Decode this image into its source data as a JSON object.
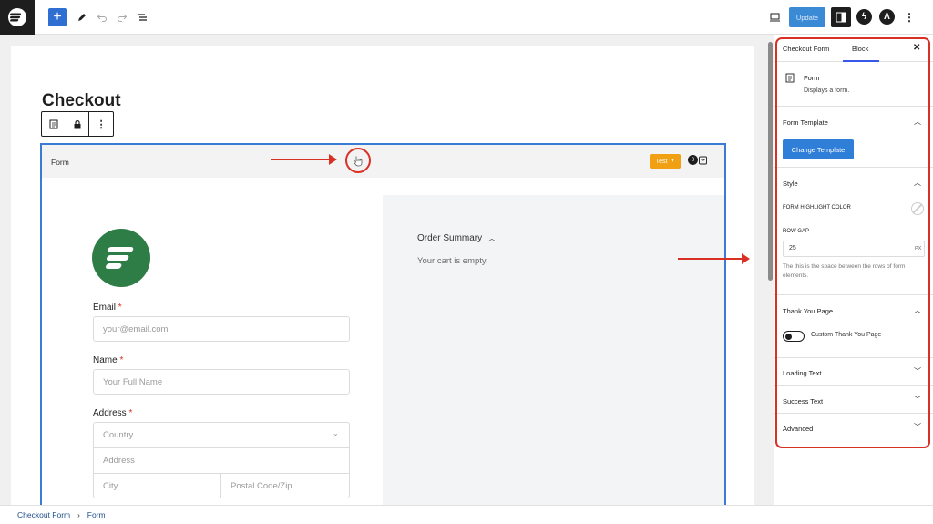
{
  "toolbar": {
    "update_label": "Update"
  },
  "page": {
    "title": "Checkout"
  },
  "form_block": {
    "label": "Form",
    "test_label": "Test",
    "cart_count": "0",
    "fields": {
      "email_label": "Email",
      "email_placeholder": "your@email.com",
      "name_label": "Name",
      "name_placeholder": "Your Full Name",
      "address_label": "Address",
      "country_placeholder": "Country",
      "address_placeholder": "Address",
      "city_placeholder": "City",
      "postal_placeholder": "Postal Code/Zip",
      "required_mark": "*"
    },
    "summary": {
      "title": "Order Summary",
      "empty_text": "Your cart is empty."
    }
  },
  "sidebar": {
    "tabs": [
      "Checkout Form",
      "Block"
    ],
    "block_name": "Form",
    "block_description": "Displays a form.",
    "sections": {
      "form_template": "Form Template",
      "change_template": "Change Template",
      "style": "Style",
      "highlight_color_label": "FORM HIGHLIGHT COLOR",
      "row_gap_label": "ROW GAP",
      "row_gap_value": "25",
      "row_gap_unit": "PX",
      "row_gap_help": "The this is the space between the rows of form elements.",
      "thank_you_page": "Thank You Page",
      "custom_thank_you": "Custom Thank You Page",
      "loading_text": "Loading Text",
      "success_text": "Success Text",
      "advanced": "Advanced"
    }
  },
  "breadcrumb": {
    "items": [
      "Checkout Form",
      "Form"
    ]
  },
  "colors": {
    "accent_blue": "#2f7ed8",
    "annotation_red": "#d93025",
    "test_orange": "#f0a012",
    "logo_green": "#2e7d46"
  }
}
